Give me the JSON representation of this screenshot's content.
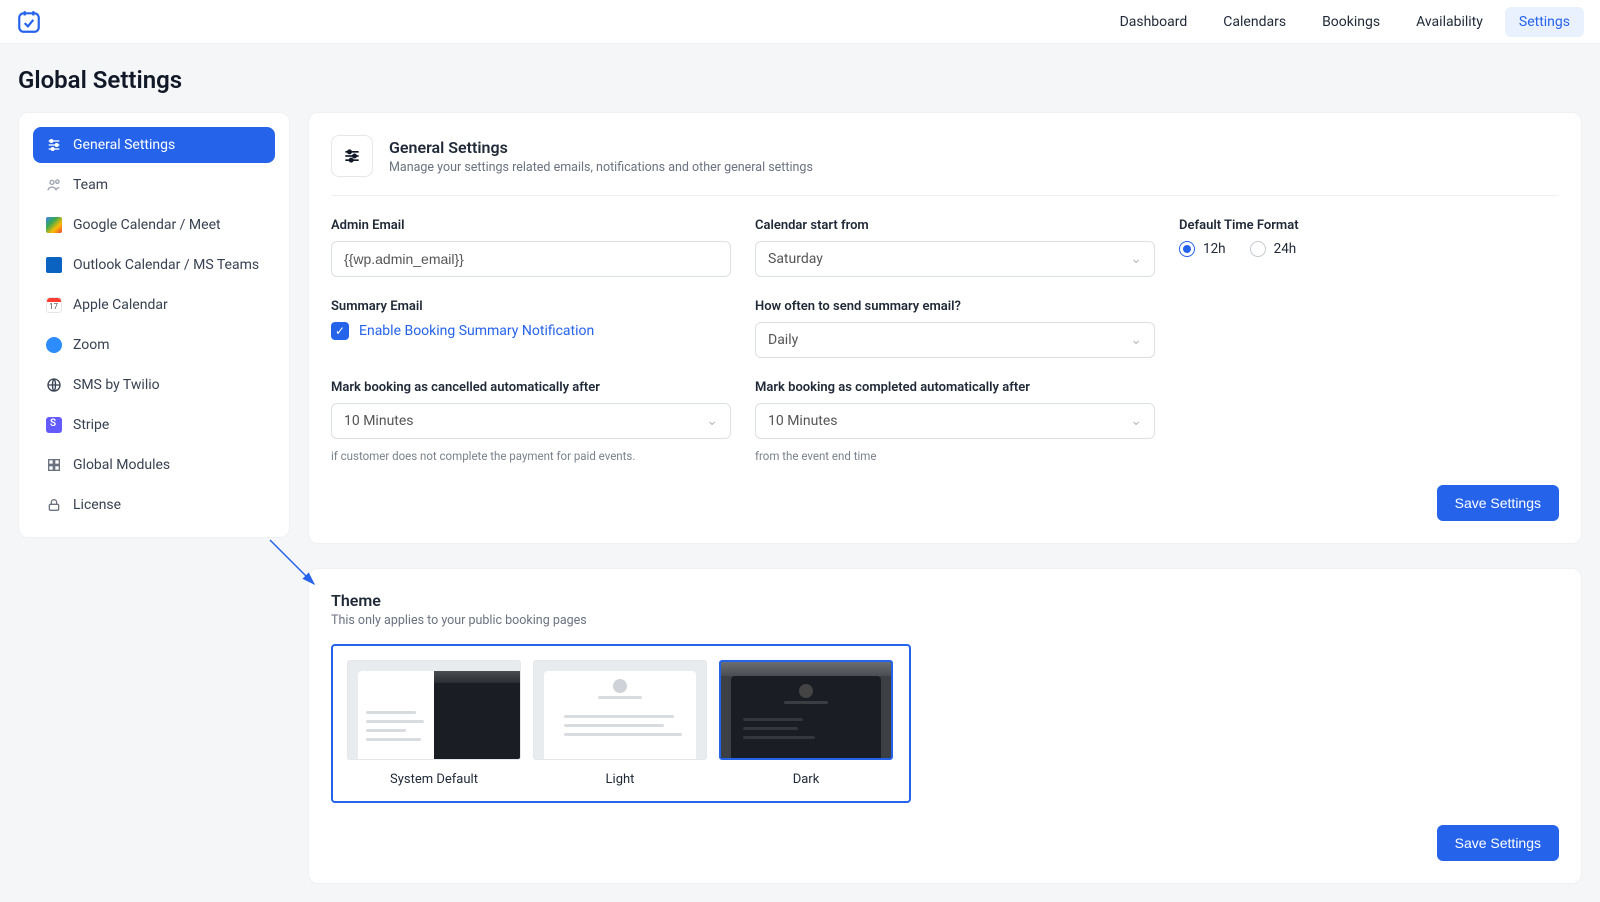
{
  "nav": {
    "dashboard": "Dashboard",
    "calendars": "Calendars",
    "bookings": "Bookings",
    "availability": "Availability",
    "settings": "Settings"
  },
  "page_title": "Global Settings",
  "sidebar": {
    "items": [
      {
        "label": "General Settings"
      },
      {
        "label": "Team"
      },
      {
        "label": "Google Calendar / Meet"
      },
      {
        "label": "Outlook Calendar / MS Teams"
      },
      {
        "label": "Apple Calendar"
      },
      {
        "label": "Zoom"
      },
      {
        "label": "SMS by Twilio"
      },
      {
        "label": "Stripe"
      },
      {
        "label": "Global Modules"
      },
      {
        "label": "License"
      }
    ]
  },
  "general": {
    "title": "General Settings",
    "subtitle": "Manage your settings related emails, notifications and other general settings",
    "admin_email_label": "Admin Email",
    "admin_email_value": "{{wp.admin_email}}",
    "calendar_start_label": "Calendar start from",
    "calendar_start_value": "Saturday",
    "time_format_label": "Default Time Format",
    "time_format_12": "12h",
    "time_format_24": "24h",
    "time_format_selected": "12h",
    "summary_label": "Summary Email",
    "summary_checkbox": "Enable Booking Summary Notification",
    "how_often_label": "How often to send summary email?",
    "how_often_value": "Daily",
    "cancel_after_label": "Mark booking as cancelled automatically after",
    "cancel_after_value": "10 Minutes",
    "cancel_help": "if customer does not complete the payment for paid events.",
    "complete_after_label": "Mark booking as completed automatically after",
    "complete_after_value": "10 Minutes",
    "complete_help": "from the event end time",
    "save_button": "Save Settings"
  },
  "theme": {
    "title": "Theme",
    "subtitle": "This only applies to your public booking pages",
    "options": [
      {
        "label": "System Default",
        "selected": false
      },
      {
        "label": "Light",
        "selected": false
      },
      {
        "label": "Dark",
        "selected": true
      }
    ],
    "save_button": "Save Settings"
  }
}
